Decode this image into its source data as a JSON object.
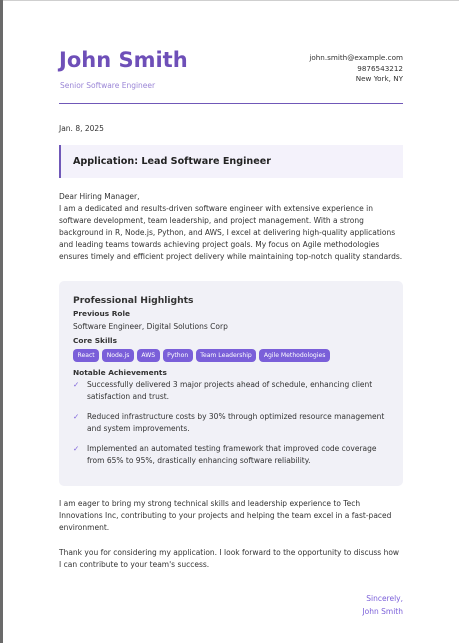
{
  "header": {
    "name": "John Smith",
    "title": "Senior Software Engineer",
    "email": "john.smith@example.com",
    "phone": "9876543212",
    "location": "New York, NY"
  },
  "date": "Jan. 8, 2025",
  "subject": "Application: Lead Software Engineer",
  "greeting": "Dear Hiring Manager,",
  "intro": "I am a dedicated and results-driven software engineer with extensive experience in software development, team leadership, and project management. With a strong background in R, Node.js, Python, and AWS, I excel at delivering high-quality applications and leading teams towards achieving project goals. My focus on Agile methodologies ensures timely and efficient project delivery while maintaining top-notch quality standards.",
  "highlights": {
    "title": "Professional Highlights",
    "previous_role_label": "Previous Role",
    "previous_role": "Software Engineer, Digital Solutions Corp",
    "core_skills_label": "Core Skills",
    "skills": [
      "React",
      "Node.js",
      "AWS",
      "Python",
      "Team Leadership",
      "Agile Methodologies"
    ],
    "achievements_label": "Notable Achievements",
    "achievements": [
      "Successfully delivered 3 major projects ahead of schedule, enhancing client satisfaction and trust.",
      "Reduced infrastructure costs by 30% through optimized resource management and system improvements.",
      "Implemented an automated testing framework that improved code coverage from 65% to 95%, drastically enhancing software reliability."
    ]
  },
  "closing_para_1": "I am eager to bring my strong technical skills and leadership experience to Tech Innovations Inc, contributing to your projects and helping the team excel in a fast-paced environment.",
  "closing_para_2": "Thank you for considering my application. I look forward to the opportunity to discuss how I can contribute to your team's success.",
  "signoff": {
    "closing": "Sincerely,",
    "name": "John Smith"
  },
  "icons": {
    "check": "check-icon"
  },
  "colors": {
    "accent": "#6e4fb8",
    "pill": "#7a5fd9",
    "panel": "#f1f1f7"
  }
}
